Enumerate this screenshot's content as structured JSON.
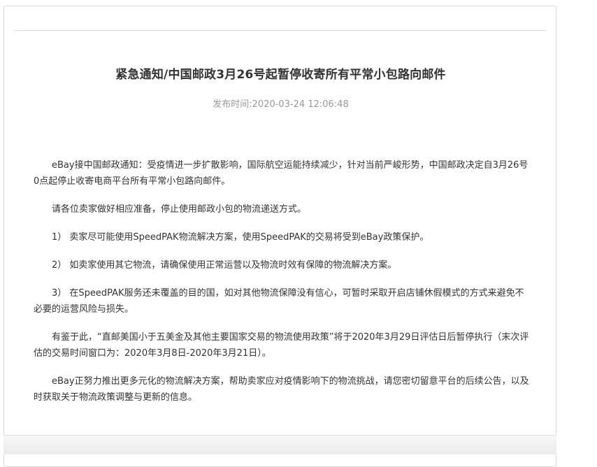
{
  "notice": {
    "title": "紧急通知/中国邮政3月26号起暂停收寄所有平常小包路向邮件",
    "publish_label": "发布时间:",
    "publish_time": "2020-03-24 12:06:48",
    "paragraphs": [
      "eBay接中国邮政通知：受疫情进一步扩散影响，国际航空运能持续减少，针对当前严峻形势，中国邮政决定自3月26号0点起停止收寄电商平台所有平常小包路向邮件。",
      "请各位卖家做好相应准备，停止使用邮政小包的物流递送方式。",
      "1） 卖家尽可能使用SpeedPAK物流解决方案，使用SpeedPAK的交易将受到eBay政策保护。",
      "2） 如卖家使用其它物流，请确保使用正常运营以及物流时效有保障的物流解决方案。",
      "3） 在SpeedPAK服务还未覆盖的目的国，如对其他物流保障没有信心，可暂时采取开启店铺休假模式的方式来避免不必要的运营风险与损失。",
      "有鉴于此，“直邮美国小于五美金及其他主要国家交易的物流使用政策”将于2020年3月29日评估日后暂停执行（末次评估的交易时间窗口为：2020年3月8日-2020年3月21日）。",
      "eBay正努力推出更多元化的物流解决方案，帮助卖家应对疫情影响下的物流挑战，请您密切留意平台的后续公告，以及时获取关于物流政策调整与更新的信息。"
    ]
  }
}
